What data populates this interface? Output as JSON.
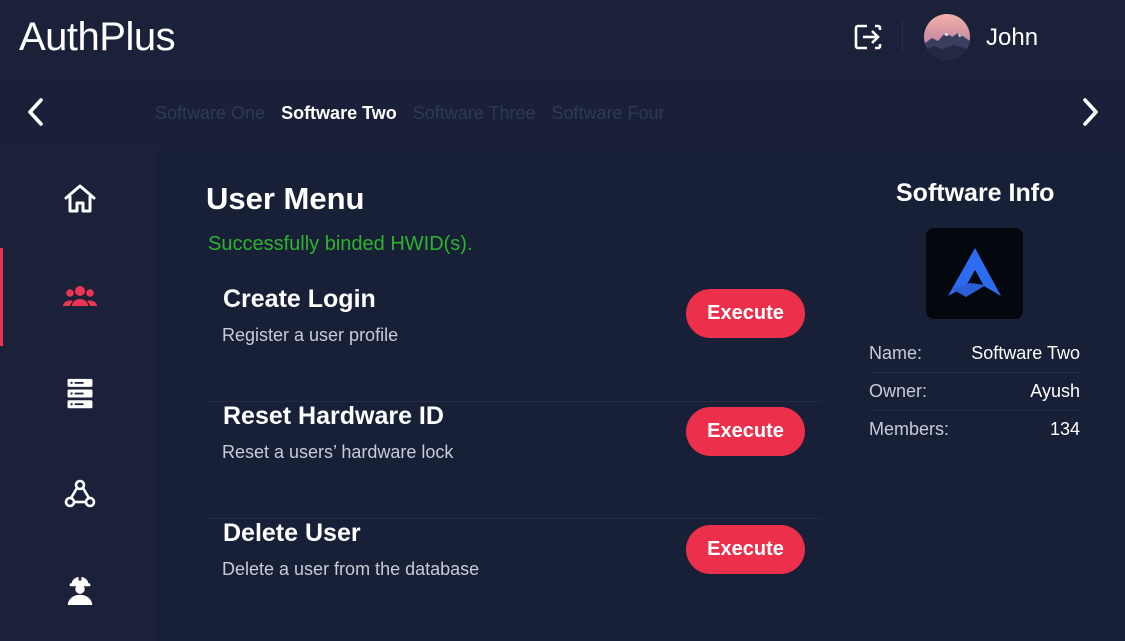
{
  "header": {
    "app_name": "AuthPlus",
    "user_name": "John"
  },
  "software_tabs": [
    {
      "label": "Software One",
      "active": false
    },
    {
      "label": "Software Two",
      "active": true
    },
    {
      "label": "Software Three",
      "active": false
    },
    {
      "label": "Software Four",
      "active": false
    }
  ],
  "sidebar": {
    "items": [
      {
        "icon": "home-icon",
        "active": false
      },
      {
        "icon": "users-icon",
        "active": true
      },
      {
        "icon": "server-icon",
        "active": false
      },
      {
        "icon": "webhook-icon",
        "active": false
      },
      {
        "icon": "worker-icon",
        "active": false
      }
    ]
  },
  "user_menu": {
    "title": "User Menu",
    "status": "Successfully binded HWID(s).",
    "actions": [
      {
        "title": "Create Login",
        "description": "Register a user profile",
        "button": "Execute"
      },
      {
        "title": "Reset Hardware ID",
        "description": "Reset a users’ hardware lock",
        "button": "Execute"
      },
      {
        "title": "Delete User",
        "description": "Delete a user from the database",
        "button": "Execute"
      }
    ]
  },
  "software_info": {
    "title": "Software Info",
    "rows": [
      {
        "key": "Name:",
        "value": "Software Two"
      },
      {
        "key": "Owner:",
        "value": "Ayush"
      },
      {
        "key": "Members:",
        "value": "134"
      }
    ]
  },
  "colors": {
    "accent": "#ec2f4b",
    "success": "#2db32d",
    "background": "#1a2139",
    "panel": "#172036"
  }
}
